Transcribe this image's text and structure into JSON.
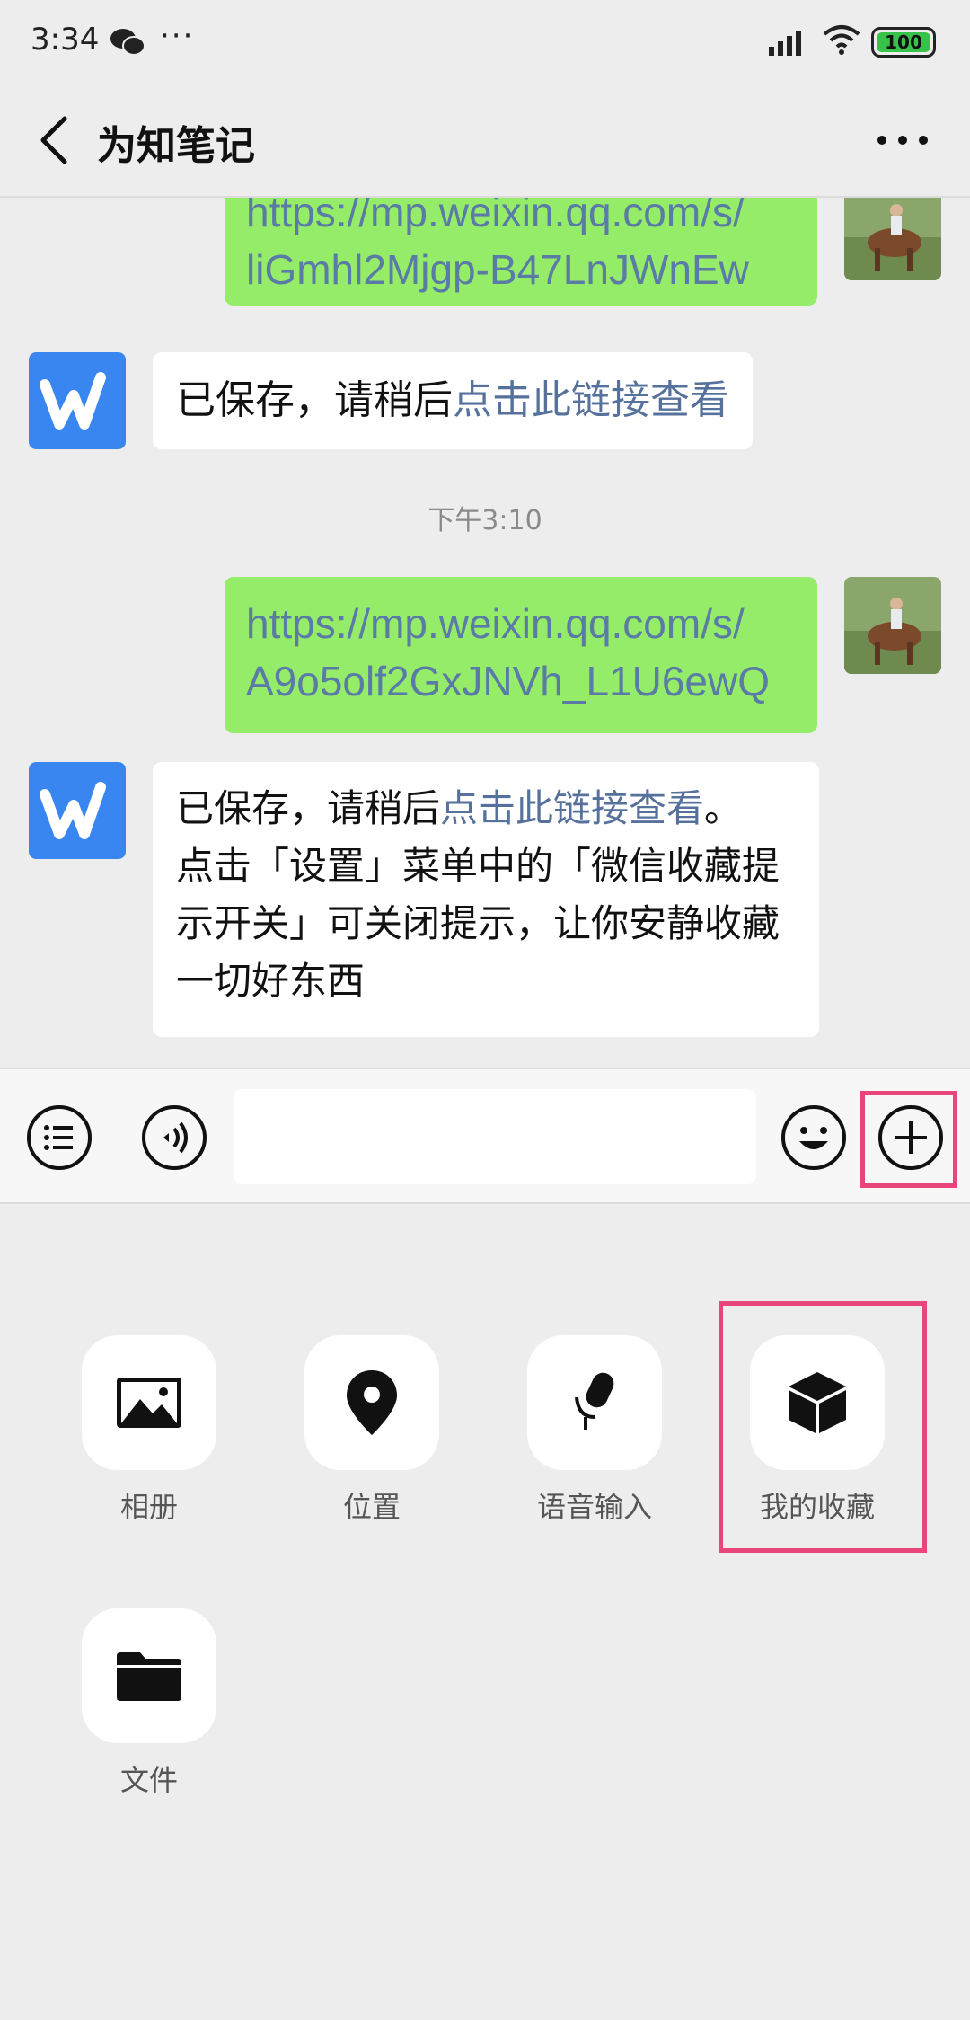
{
  "status_bar": {
    "time": "3:34",
    "dots": "···",
    "battery": "100"
  },
  "header": {
    "title": "为知笔记"
  },
  "messages": {
    "m1_link_line1": "https://mp.weixin.qq.com/s/",
    "m1_link_line2": "liGmhl2Mjgp-B47LnJWnEw",
    "m2_text": "已保存，请稍后",
    "m2_link": "点击此链接查看",
    "timestamp": "下午3:10",
    "m3_link_line1": "https://mp.weixin.qq.com/s/",
    "m3_link_line2": "A9o5olf2GxJNVh_L1U6ewQ",
    "m4_line1_text": "已保存，请稍后",
    "m4_line1_link": "点击此链接查看",
    "m4_line1_end": "。",
    "m4_line2": "点击「设置」菜单中的「微信收藏提",
    "m4_line3": "示开关」可关闭提示，让你安静收藏",
    "m4_line4": "一切好东西"
  },
  "panel": {
    "items": [
      {
        "label": "相册",
        "icon": "image-icon"
      },
      {
        "label": "位置",
        "icon": "location-icon"
      },
      {
        "label": "语音输入",
        "icon": "microphone-icon"
      },
      {
        "label": "我的收藏",
        "icon": "cube-icon"
      },
      {
        "label": "文件",
        "icon": "folder-icon"
      }
    ]
  },
  "colors": {
    "bubble_green": "#95ec69",
    "link": "#56729c",
    "highlight": "#e8457a"
  }
}
